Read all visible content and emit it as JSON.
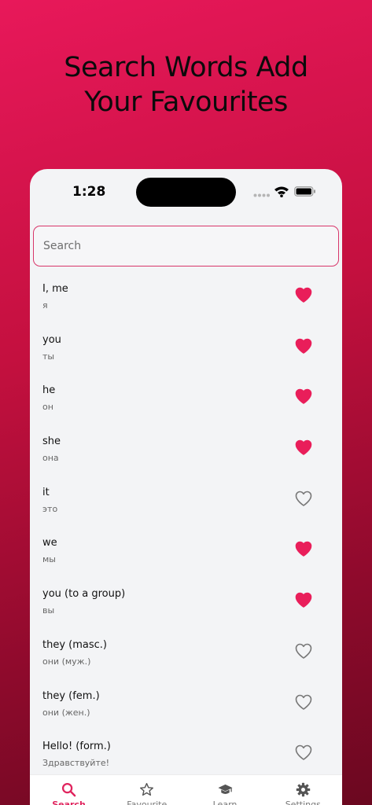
{
  "promo": {
    "line1": "Search Words Add",
    "line2": "Your Favourites"
  },
  "status": {
    "time": "1:28"
  },
  "colors": {
    "accent": "#e0245e",
    "heart_filled": "#e91e5a",
    "heart_outline": "#777777"
  },
  "search": {
    "placeholder": "Search"
  },
  "words": [
    {
      "term": "I, me",
      "translation": "я",
      "favourite": true
    },
    {
      "term": "you",
      "translation": "ты",
      "favourite": true
    },
    {
      "term": "he",
      "translation": "он",
      "favourite": true
    },
    {
      "term": "she",
      "translation": "она",
      "favourite": true
    },
    {
      "term": "it",
      "translation": "это",
      "favourite": false
    },
    {
      "term": "we",
      "translation": "мы",
      "favourite": true
    },
    {
      "term": "you (to a group)",
      "translation": "вы",
      "favourite": true
    },
    {
      "term": "they (masc.)",
      "translation": "они (муж.)",
      "favourite": false
    },
    {
      "term": "they (fem.)",
      "translation": "они (жен.)",
      "favourite": false
    },
    {
      "term": "Hello! (form.)",
      "translation": "Здравствуйте!",
      "favourite": false
    }
  ],
  "tabs": [
    {
      "label": "Search",
      "icon": "search-icon",
      "active": true
    },
    {
      "label": "Favourite",
      "icon": "star-icon",
      "active": false
    },
    {
      "label": "Learn",
      "icon": "graduation-cap-icon",
      "active": false
    },
    {
      "label": "Settings",
      "icon": "gear-icon",
      "active": false
    }
  ]
}
